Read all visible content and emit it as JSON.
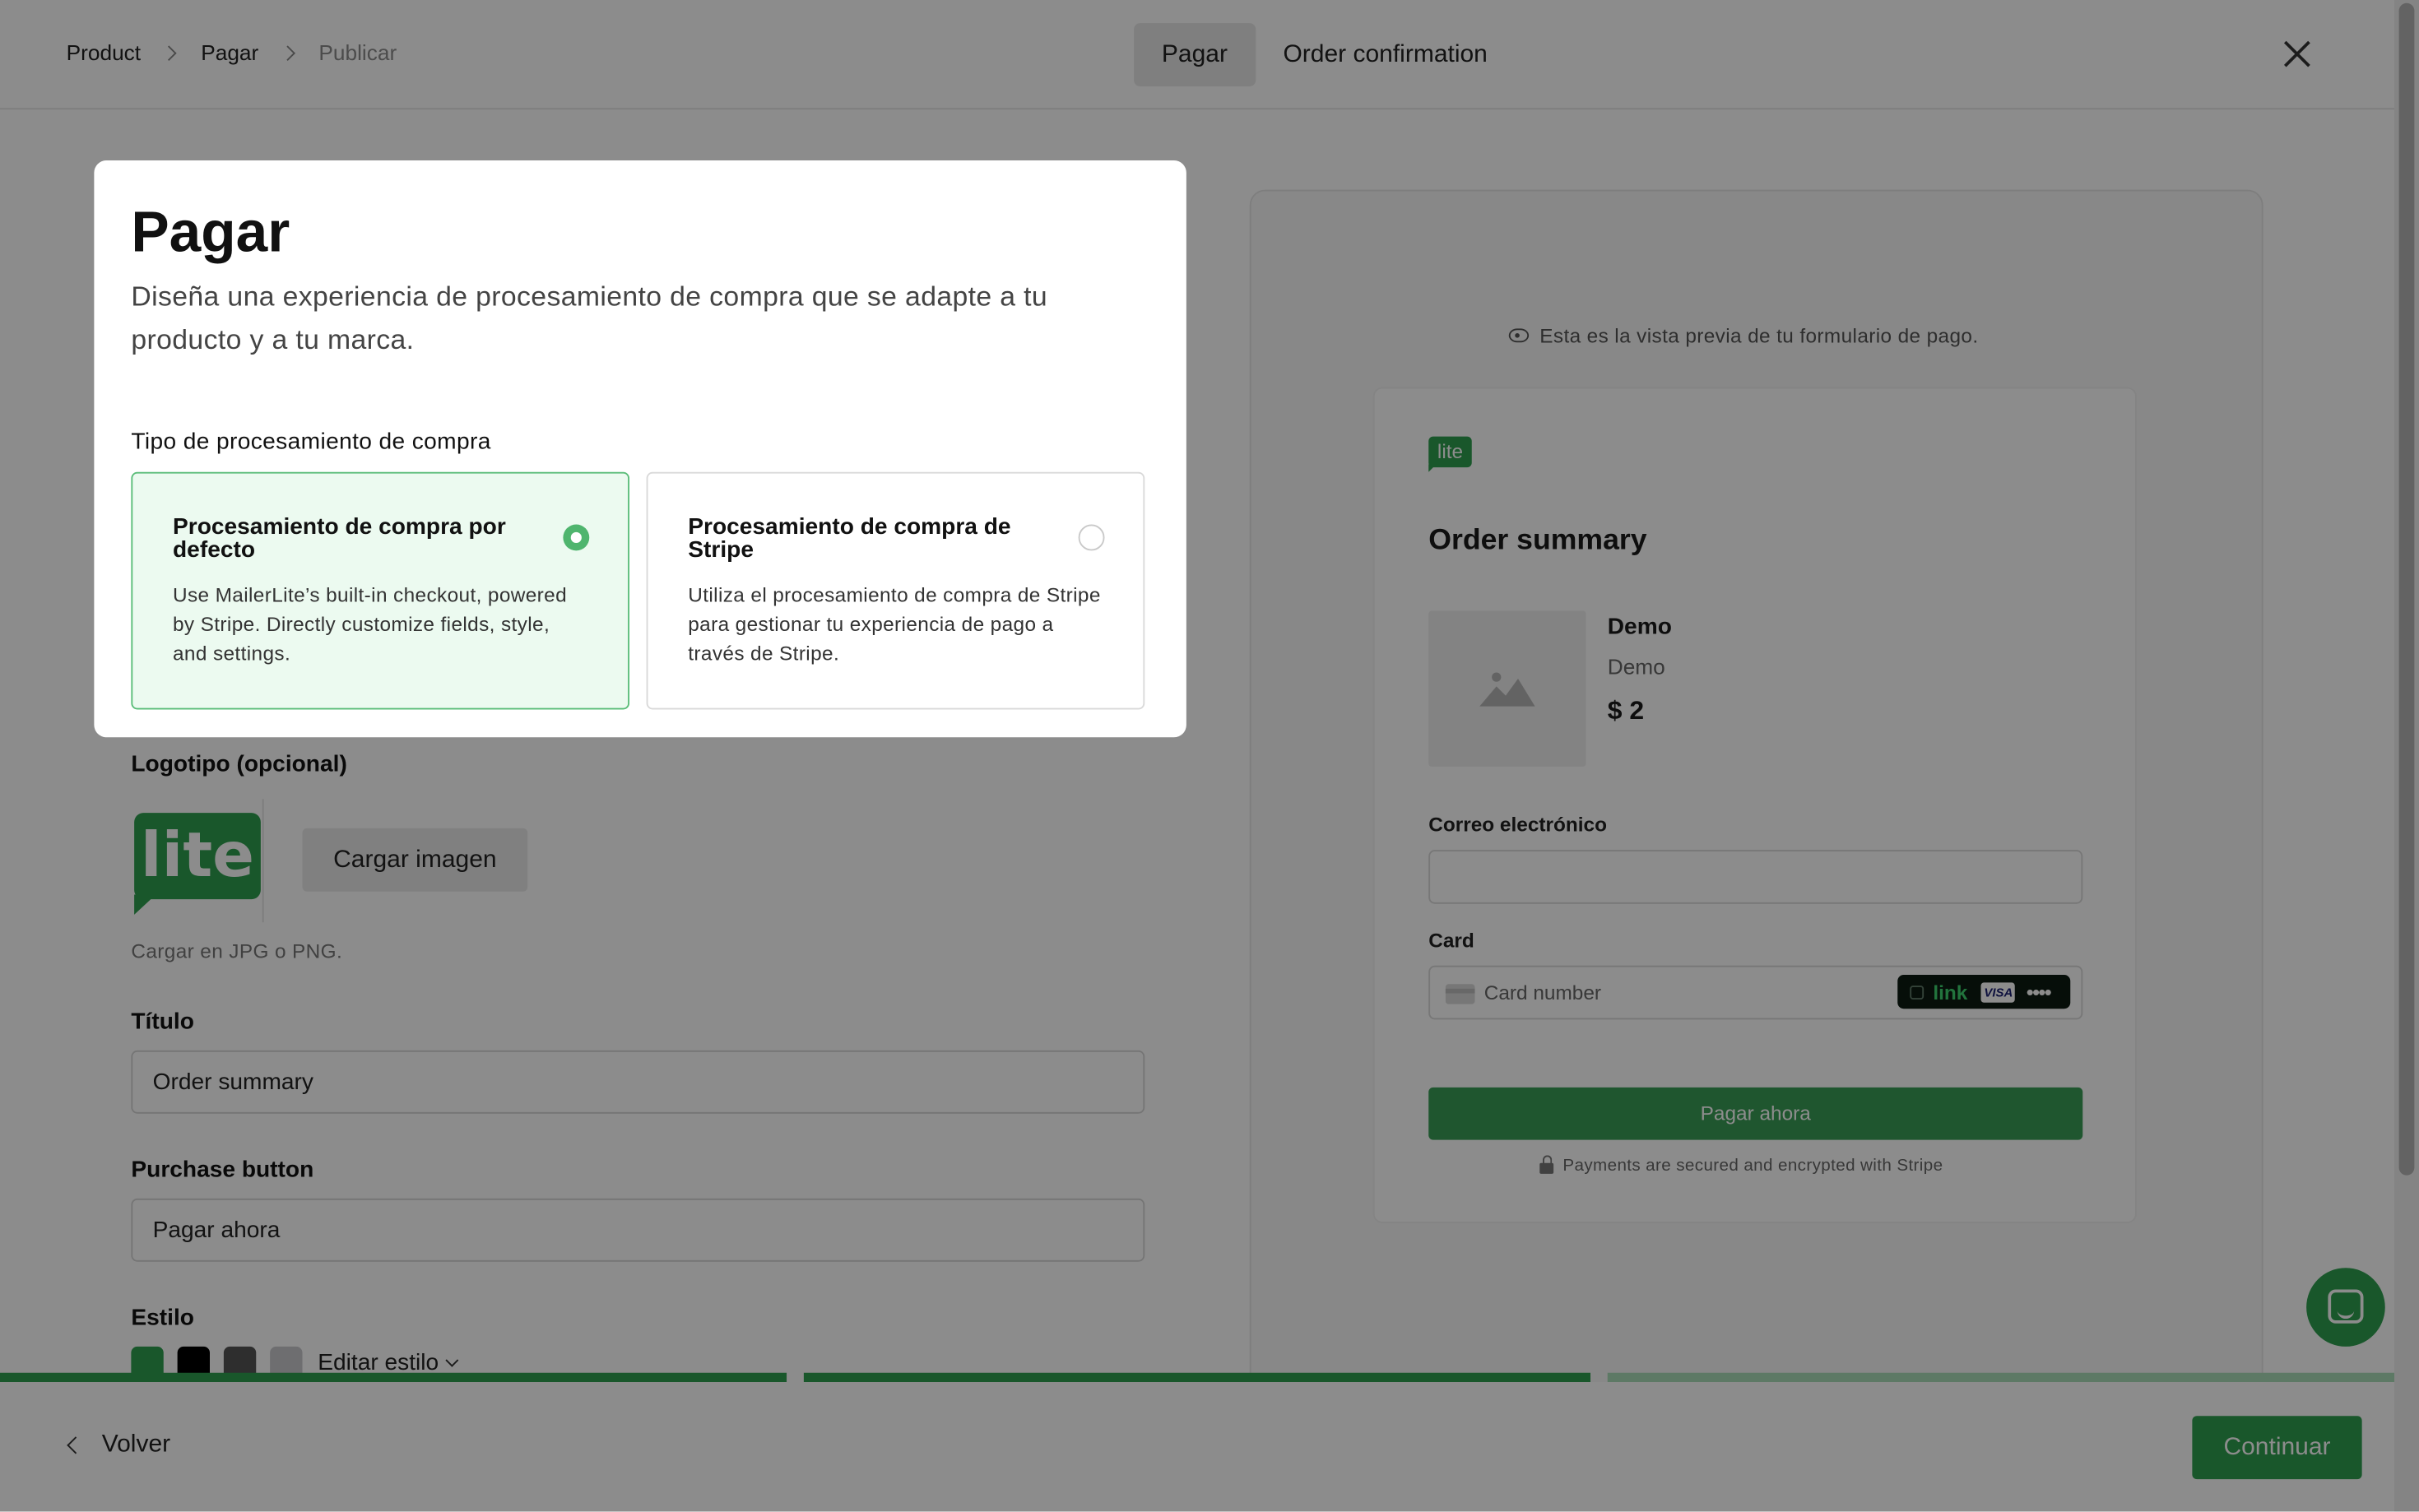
{
  "header": {
    "breadcrumb": [
      "Product",
      "Pagar",
      "Publicar"
    ],
    "tabs": [
      "Pagar",
      "Order confirmation"
    ],
    "active_tab": "Pagar"
  },
  "form": {
    "logo_label": "Logotipo (opcional)",
    "logo_text": "lite",
    "upload_button": "Cargar imagen",
    "upload_hint": "Cargar en JPG o PNG.",
    "title_label": "Título",
    "title_value": "Order summary",
    "purchase_label": "Purchase button",
    "purchase_value": "Pagar ahora",
    "style_label": "Estilo",
    "swatches": [
      "#2f9e4f",
      "#000000",
      "#555555",
      "#c9c9cd"
    ],
    "edit_style": "Editar estilo"
  },
  "preview": {
    "note": "Esta es la vista previa de tu formulario de pago.",
    "logo_text": "lite",
    "summary_title": "Order summary",
    "product_name": "Demo",
    "product_desc": "Demo",
    "product_price": "$ 2",
    "email_label": "Correo electrónico",
    "card_label": "Card",
    "card_placeholder": "Card number",
    "link_text": "link",
    "visa_text": "VISA",
    "dots": "••••",
    "pay_button": "Pagar ahora",
    "secure_note": "Payments are secured and encrypted with Stripe"
  },
  "progress": {
    "segments": [
      {
        "fill": 1.0,
        "color": "#2f9e4f"
      },
      {
        "fill": 1.0,
        "color": "#2f9e4f"
      },
      {
        "fill": 1.0,
        "color": "#a9dcb8"
      }
    ]
  },
  "footer": {
    "back": "Volver",
    "continue": "Continuar"
  },
  "modal": {
    "title": "Pagar",
    "description": "Diseña una experiencia de procesamiento de compra que se adapte a tu producto y a tu marca.",
    "subtitle": "Tipo de procesamiento de compra",
    "options": [
      {
        "title": "Procesamiento de compra por defecto",
        "body": "Use MailerLite’s built-in checkout, powered by Stripe. Directly customize fields, style, and settings.",
        "selected": true
      },
      {
        "title": "Procesamiento de compra de Stripe",
        "body": "Utiliza el procesamiento de compra de Stripe para gestionar tu experiencia de pago a través de Stripe.",
        "selected": false
      }
    ]
  },
  "colors": {
    "brand_green": "#2f9e4f",
    "selected_bg": "#ecfaf0",
    "selected_border": "#5bbd79"
  }
}
